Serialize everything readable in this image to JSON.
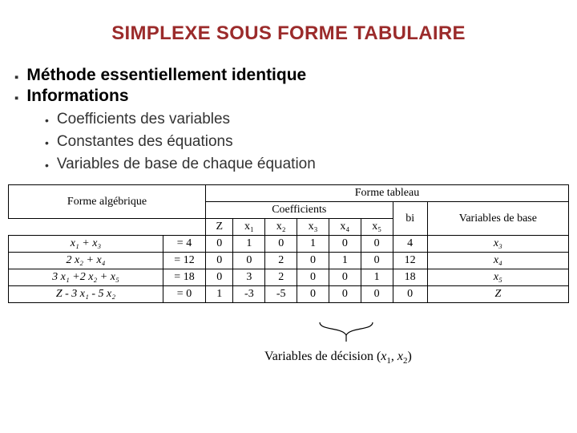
{
  "title": "SIMPLEXE SOUS FORME TABULAIRE",
  "bul1": [
    "Méthode essentiellement identique",
    "Informations"
  ],
  "bul2": [
    "Coefficients des variables",
    "Constantes des équations",
    "Variables de base de chaque équation"
  ],
  "hdr": {
    "alg": "Forme algébrique",
    "tab": "Forme tableau",
    "coef": "Coefficients",
    "vars": "Variables de base",
    "Z": "Z",
    "x1": "x₁",
    "x2": "x₂",
    "x3": "x₃",
    "x4": "x₄",
    "x5": "x₅",
    "bi": "bi"
  },
  "rows": [
    {
      "alg_l": "  x₁              + x₃",
      "alg_r": "= 4",
      "Z": "0",
      "x1": "1",
      "x2": "0",
      "x3": "1",
      "x4": "0",
      "x5": "0",
      "bi": "4",
      "vb": "x₃"
    },
    {
      "alg_l": "        2 x₂               + x₄",
      "alg_r": "= 12",
      "Z": "0",
      "x1": "0",
      "x2": "2",
      "x3": "0",
      "x4": "1",
      "x5": "0",
      "bi": "12",
      "vb": "x₄"
    },
    {
      "alg_l": "3 x₁ +2 x₂               + x₅",
      "alg_r": "= 18",
      "Z": "0",
      "x1": "3",
      "x2": "2",
      "x3": "0",
      "x4": "0",
      "x5": "1",
      "bi": "18",
      "vb": "x₅"
    },
    {
      "alg_l": "Z -  3 x₁  - 5 x₂",
      "alg_r": "= 0",
      "Z": "1",
      "x1": "-3",
      "x2": "-5",
      "x3": "0",
      "x4": "0",
      "x5": "0",
      "bi": "0",
      "vb": "Z"
    }
  ],
  "annot": {
    "pre": "Variables de décision (",
    "x1": "x",
    "s1": "1",
    "mid": ", ",
    "x2": "x",
    "s2": "2",
    "post": ")"
  },
  "chart_data": {
    "type": "table",
    "title": "Forme tableau — Coefficients",
    "columns": [
      "Z",
      "x1",
      "x2",
      "x3",
      "x4",
      "x5",
      "bi",
      "Variable de base"
    ],
    "rows": [
      [
        0,
        1,
        0,
        1,
        0,
        0,
        4,
        "x3"
      ],
      [
        0,
        0,
        2,
        0,
        1,
        0,
        12,
        "x4"
      ],
      [
        0,
        3,
        2,
        0,
        0,
        1,
        18,
        "x5"
      ],
      [
        1,
        -3,
        -5,
        0,
        0,
        0,
        0,
        "Z"
      ]
    ],
    "algebraic": [
      "x1 + x3 = 4",
      "2 x2 + x4 = 12",
      "3 x1 + 2 x2 + x5 = 18",
      "Z - 3 x1 - 5 x2 = 0"
    ],
    "decision_variables": [
      "x1",
      "x2"
    ]
  }
}
